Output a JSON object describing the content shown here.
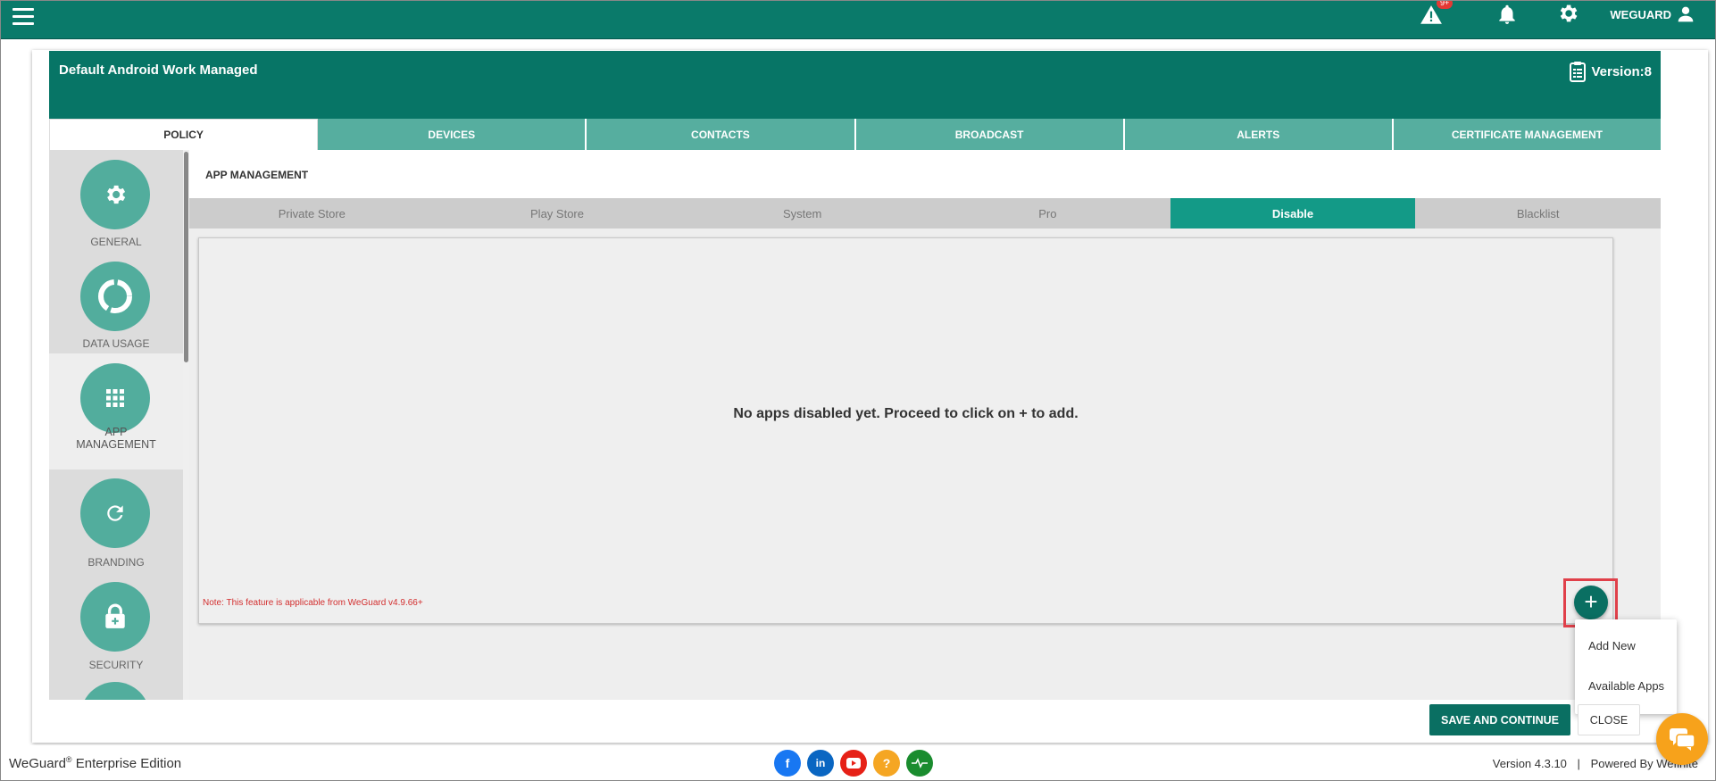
{
  "topbar": {
    "alert_badge": "9+",
    "user_label": "WEGUARD"
  },
  "header": {
    "title": "Default Android Work Managed",
    "version": "Version:8"
  },
  "tabs": [
    {
      "label": "POLICY",
      "active": true
    },
    {
      "label": "DEVICES",
      "active": false
    },
    {
      "label": "CONTACTS",
      "active": false
    },
    {
      "label": "BROADCAST",
      "active": false
    },
    {
      "label": "ALERTS",
      "active": false
    },
    {
      "label": "CERTIFICATE MANAGEMENT",
      "active": false
    }
  ],
  "sidebar": {
    "items": [
      {
        "label": "GENERAL",
        "icon": "gear-icon"
      },
      {
        "label": "DATA USAGE",
        "icon": "donut-icon"
      },
      {
        "label": "APP MANAGEMENT",
        "icon": "grid-icon",
        "active": true
      },
      {
        "label": "BRANDING",
        "icon": "refresh-icon"
      },
      {
        "label": "SECURITY",
        "icon": "lock-icon"
      }
    ]
  },
  "section": {
    "title": "APP MANAGEMENT"
  },
  "subtabs": [
    {
      "label": "Private Store"
    },
    {
      "label": "Play Store"
    },
    {
      "label": "System"
    },
    {
      "label": "Pro"
    },
    {
      "label": "Disable",
      "active": true
    },
    {
      "label": "Blacklist"
    }
  ],
  "panel": {
    "empty_message": "No apps disabled yet. Proceed to click on + to add.",
    "note": "Note: This feature is applicable from WeGuard v4.9.66+"
  },
  "fab": {
    "label": "+"
  },
  "add_menu": {
    "items": [
      "Add New",
      "Available Apps"
    ]
  },
  "actions": {
    "save_label": "SAVE AND CONTINUE",
    "close_label": "CLOSE"
  },
  "footer": {
    "brand": "WeGuard",
    "reg": "®",
    "edition": " Enterprise Edition",
    "version": "Version 4.3.10",
    "powered": "Powered By Wefinite"
  },
  "colors": {
    "primary": "#0a7a6a",
    "accent": "#139a87",
    "sidebar_circle": "#52ad9d",
    "note_red": "#d32f2f",
    "chat": "#f7a21b"
  }
}
